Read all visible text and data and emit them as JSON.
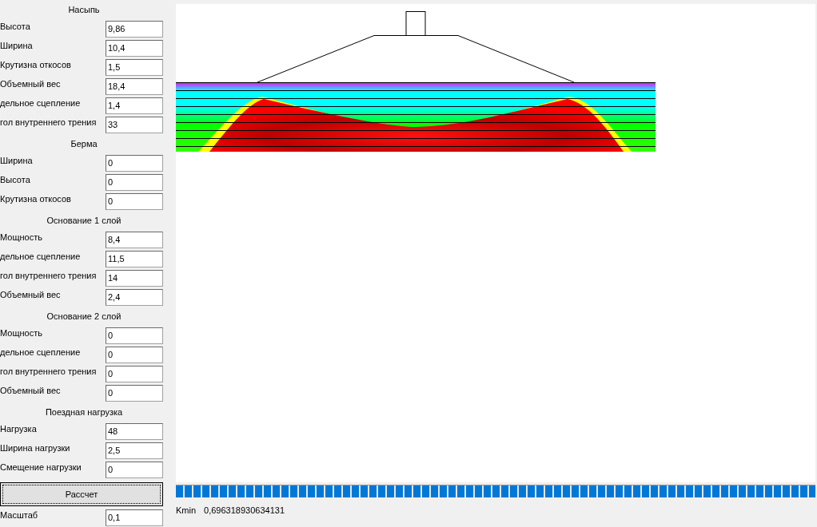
{
  "sections": [
    {
      "title": "Насыпь",
      "fields": [
        {
          "label": "Высота",
          "value": "9,86"
        },
        {
          "label": "Ширина",
          "value": "10,4"
        },
        {
          "label": "Крутизна откосов",
          "value": "1,5"
        },
        {
          "label": "Объемный вес",
          "value": "18,4"
        },
        {
          "label": "дельное сцепление",
          "value": "1,4"
        },
        {
          "label": "гол внутреннего трения",
          "value": "33"
        }
      ]
    },
    {
      "title": "Берма",
      "fields": [
        {
          "label": "Ширина",
          "value": "0"
        },
        {
          "label": "Высота",
          "value": "0"
        },
        {
          "label": "Крутизна откосов",
          "value": "0"
        }
      ]
    },
    {
      "title": "Основание 1 слой",
      "fields": [
        {
          "label": "Мощность",
          "value": "8,4"
        },
        {
          "label": "дельное сцепление",
          "value": "11,5"
        },
        {
          "label": "гол внутреннего трения",
          "value": "14"
        },
        {
          "label": "Объемный вес",
          "value": "2,4"
        }
      ]
    },
    {
      "title": "Основание 2 слой",
      "fields": [
        {
          "label": "Мощность",
          "value": "0"
        },
        {
          "label": "дельное сцепление",
          "value": "0"
        },
        {
          "label": "гол внутреннего трения",
          "value": "0"
        },
        {
          "label": "Объемный вес",
          "value": "0"
        }
      ]
    },
    {
      "title": "Поездная нагрузка",
      "fields": [
        {
          "label": "Нагрузка",
          "value": "48"
        },
        {
          "label": "Ширина нагрузки",
          "value": "2,5"
        },
        {
          "label": "Смещение  нагрузки",
          "value": "0"
        }
      ]
    }
  ],
  "calculate_button": "Рассчет",
  "scale": {
    "label": "Масштаб",
    "value": "0,1"
  },
  "progress": {
    "level": 1
  },
  "result": {
    "label": "Kmin",
    "value": "0,696318930634131"
  }
}
